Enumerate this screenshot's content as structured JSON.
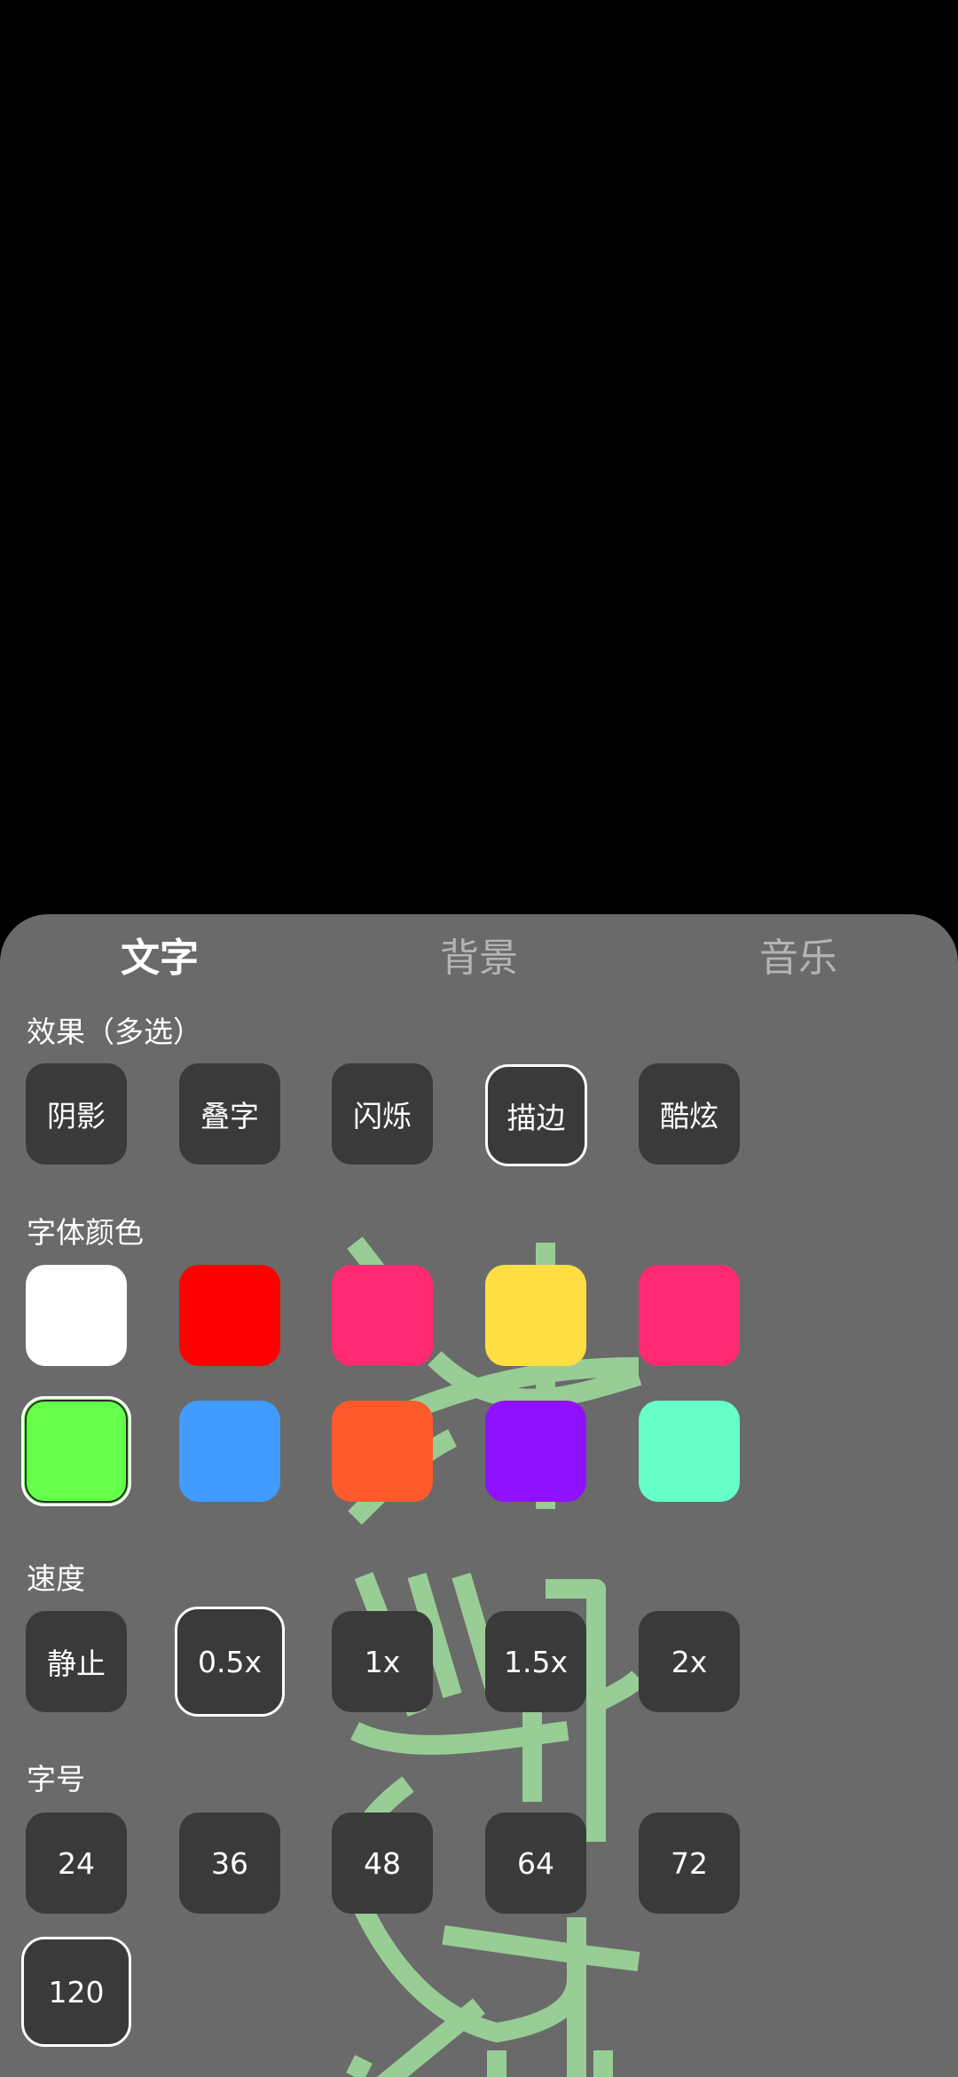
{
  "tabs": [
    {
      "label": "文字",
      "active": true
    },
    {
      "label": "背景",
      "active": false
    },
    {
      "label": "音乐",
      "active": false
    }
  ],
  "effects": {
    "label": "效果（多选）",
    "options": [
      "阴影",
      "叠字",
      "闪烁",
      "描边",
      "酷炫"
    ],
    "selected": "描边"
  },
  "font_color": {
    "label": "字体颜色",
    "colors": [
      "#ffffff",
      "#ff0000",
      "#ff2a72",
      "#ffde44",
      "#ff2a72",
      "#66ff4a",
      "#409cff",
      "#ff5a2c",
      "#8f12ff",
      "#66ffc8"
    ],
    "selected": "#66ff4a"
  },
  "speed": {
    "label": "速度",
    "options": [
      "静止",
      "0.5x",
      "1x",
      "1.5x",
      "2x"
    ],
    "selected": "0.5x"
  },
  "font_size": {
    "label": "字号",
    "options": [
      "24",
      "36",
      "48",
      "64",
      "72",
      "120"
    ],
    "selected": "120"
  }
}
